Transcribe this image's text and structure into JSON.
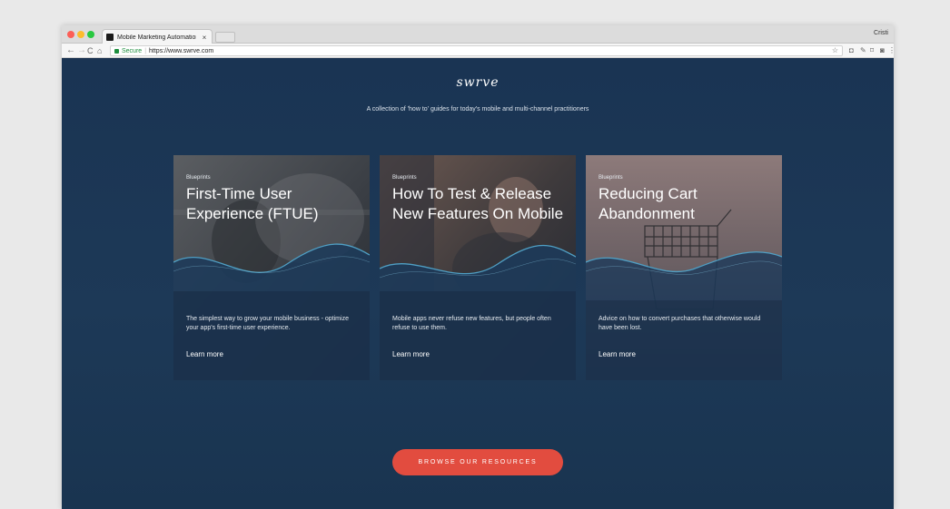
{
  "browser": {
    "tab_title": "Mobile Marketing Automation,",
    "tab_close": "×",
    "profile_name": "Cristi",
    "secure_label": "Secure",
    "separator": "|",
    "url": "https://www.swrve.com",
    "icons": {
      "back": "←",
      "forward": "→",
      "reload": "C",
      "home": "⌂",
      "star": "☆",
      "pocket": "◘",
      "pencil": "✎",
      "cast": "⌑",
      "camera": "◙",
      "menu": "⋮"
    }
  },
  "page": {
    "logo": "swrve",
    "tagline": "A collection of 'how to' guides for today's mobile and multi-channel practitioners",
    "cards": [
      {
        "kicker": "Blueprints",
        "title": "First-Time User Experience (FTUE)",
        "description": "The simplest way to grow your mobile business - optimize your app's first-time user experience.",
        "link": "Learn more"
      },
      {
        "kicker": "Blueprints",
        "title": "How To Test & Release New Features On Mobile",
        "description": "Mobile apps never refuse new features, but people often refuse to use them.",
        "link": "Learn more"
      },
      {
        "kicker": "Blueprints",
        "title": "Reducing Cart Abandonment",
        "description": "Advice on how to convert purchases that otherwise would have been lost.",
        "link": "Learn more"
      }
    ],
    "cta_label": "BROWSE OUR RESOURCES"
  },
  "colors": {
    "page_bg": "#1a3453",
    "wave": "#3f8fb6",
    "cta": "#e24c3f"
  }
}
